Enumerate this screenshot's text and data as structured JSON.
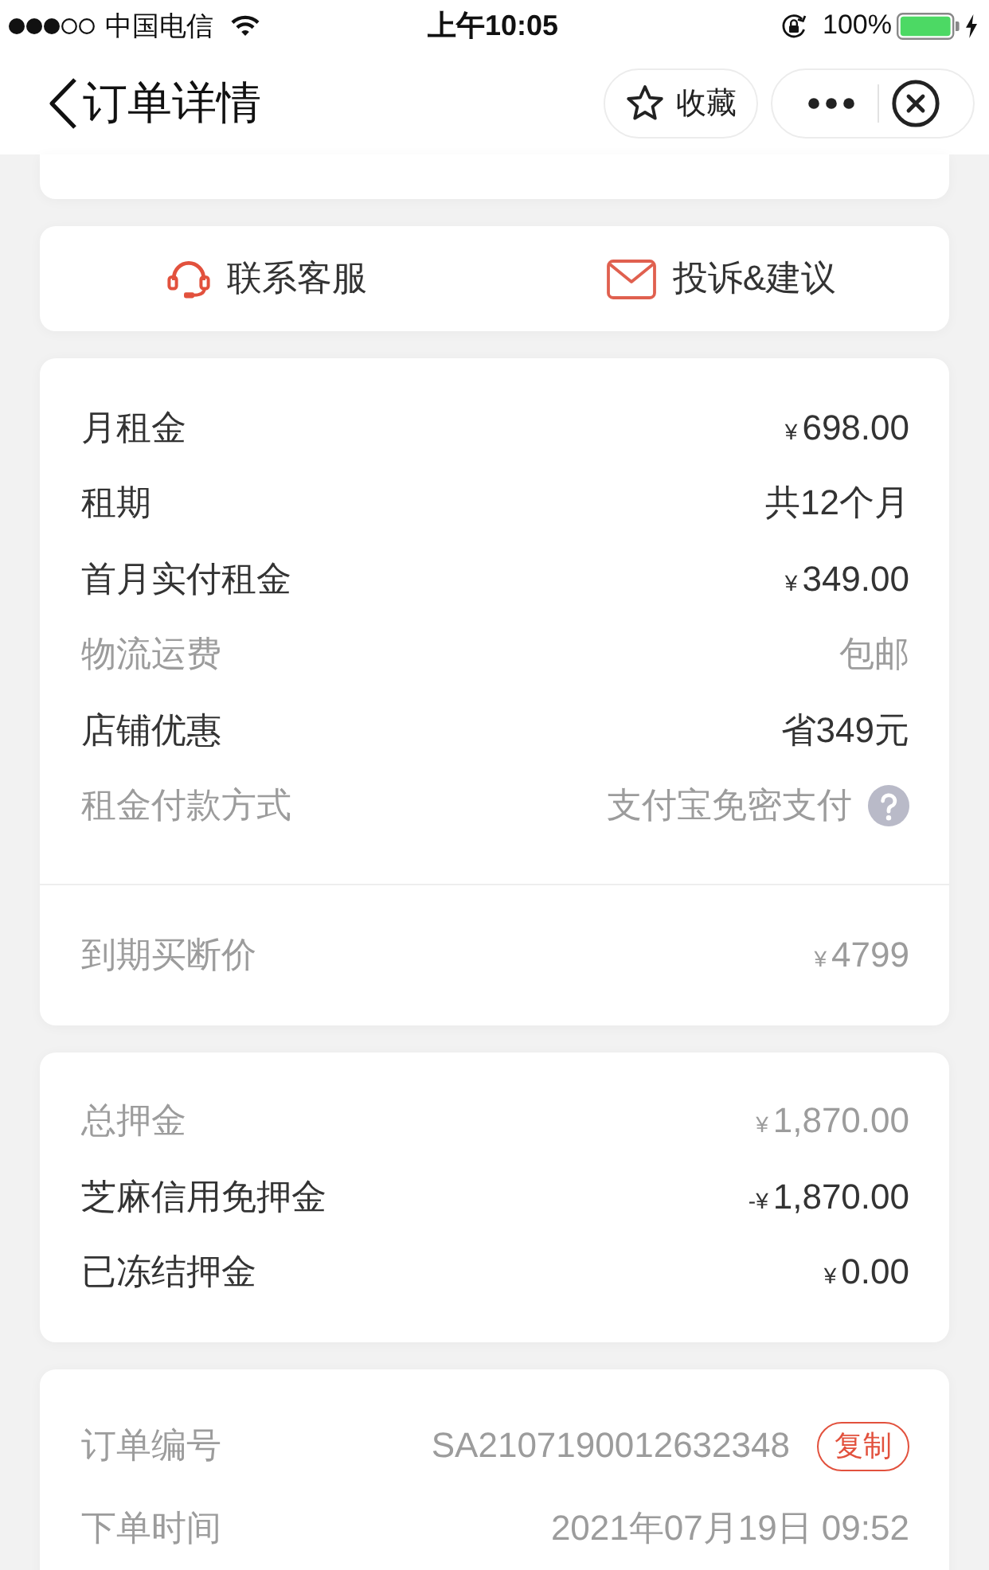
{
  "status_bar": {
    "carrier": "中国电信",
    "time": "上午10:05",
    "battery": "100%"
  },
  "nav": {
    "title": "订单详情",
    "favorite_label": "收藏"
  },
  "service_actions": [
    {
      "kind": "headset",
      "label": "联系客服"
    },
    {
      "kind": "mail",
      "label": "投诉&建议"
    }
  ],
  "rent_card": {
    "rows": [
      {
        "kind": "text",
        "label": "月租金",
        "prefix": "¥",
        "value": "698.00",
        "muted": false
      },
      {
        "kind": "text",
        "label": "租期",
        "value": "共12个月",
        "muted": false
      },
      {
        "kind": "text",
        "label": "首月实付租金",
        "prefix": "¥",
        "value": "349.00",
        "muted": false
      },
      {
        "kind": "text",
        "label": "物流运费",
        "value": "包邮",
        "muted": true
      },
      {
        "kind": "text",
        "label": "店铺优惠",
        "value": "省349元",
        "muted": false
      },
      {
        "kind": "help",
        "label": "租金付款方式",
        "value": "支付宝免密支付",
        "muted": true
      }
    ],
    "buyout_rows": [
      {
        "kind": "text",
        "label": "到期买断价",
        "prefix": "¥",
        "value": "4799",
        "muted": true
      }
    ]
  },
  "deposit_card": {
    "rows": [
      {
        "kind": "text",
        "label": "总押金",
        "prefix": "¥",
        "value": "1,870.00",
        "muted": true
      },
      {
        "kind": "text",
        "label": "芝麻信用免押金",
        "prefix": "-¥",
        "value": "1,870.00",
        "muted": false
      },
      {
        "kind": "text",
        "label": "已冻结押金",
        "prefix": "¥",
        "value": "0.00",
        "muted": false
      }
    ]
  },
  "order_card": {
    "rows": [
      {
        "kind": "copy",
        "label": "订单编号",
        "value": "SA2107190012632348",
        "action_label": "复制",
        "muted": true
      },
      {
        "kind": "text",
        "label": "下单时间",
        "value": "2021年07月19日 09:52",
        "muted": true
      }
    ]
  }
}
